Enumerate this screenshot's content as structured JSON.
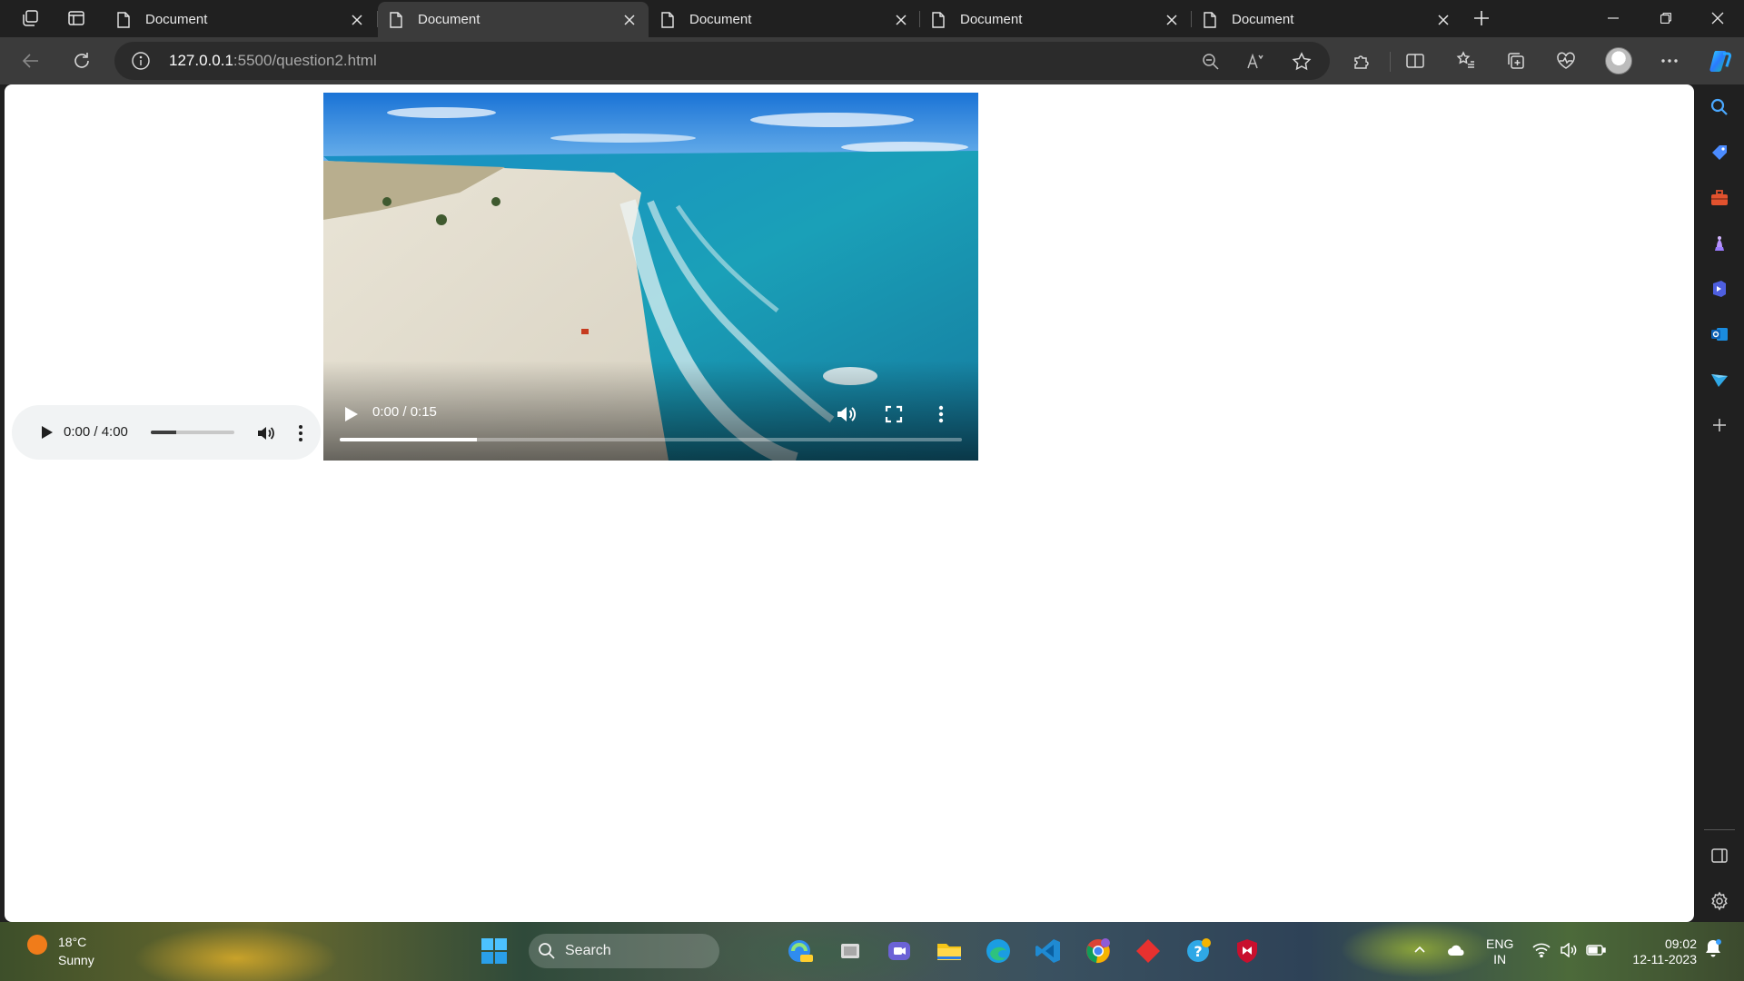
{
  "browser": {
    "tabs": [
      {
        "title": "Document",
        "active": false
      },
      {
        "title": "Document",
        "active": true
      },
      {
        "title": "Document",
        "active": false
      },
      {
        "title": "Document",
        "active": false
      },
      {
        "title": "Document",
        "active": false
      }
    ],
    "address": {
      "host": "127.0.0.1",
      "path": ":5500/question2.html"
    }
  },
  "page": {
    "audio": {
      "time": "0:00 / 4:00",
      "volume_level": 0.3
    },
    "video": {
      "time": "0:00 / 0:15",
      "progress": 0.22
    }
  },
  "taskbar": {
    "weather_temp": "18°C",
    "weather_condition": "Sunny",
    "search_label": "Search",
    "lang_top": "ENG",
    "lang_bottom": "IN",
    "time": "09:02",
    "date": "12-11-2023"
  },
  "colors": {
    "accent": "#0078d4",
    "tab_active": "#3b3b3b",
    "toolbar": "#3b3b3b",
    "chrome": "#202020"
  }
}
